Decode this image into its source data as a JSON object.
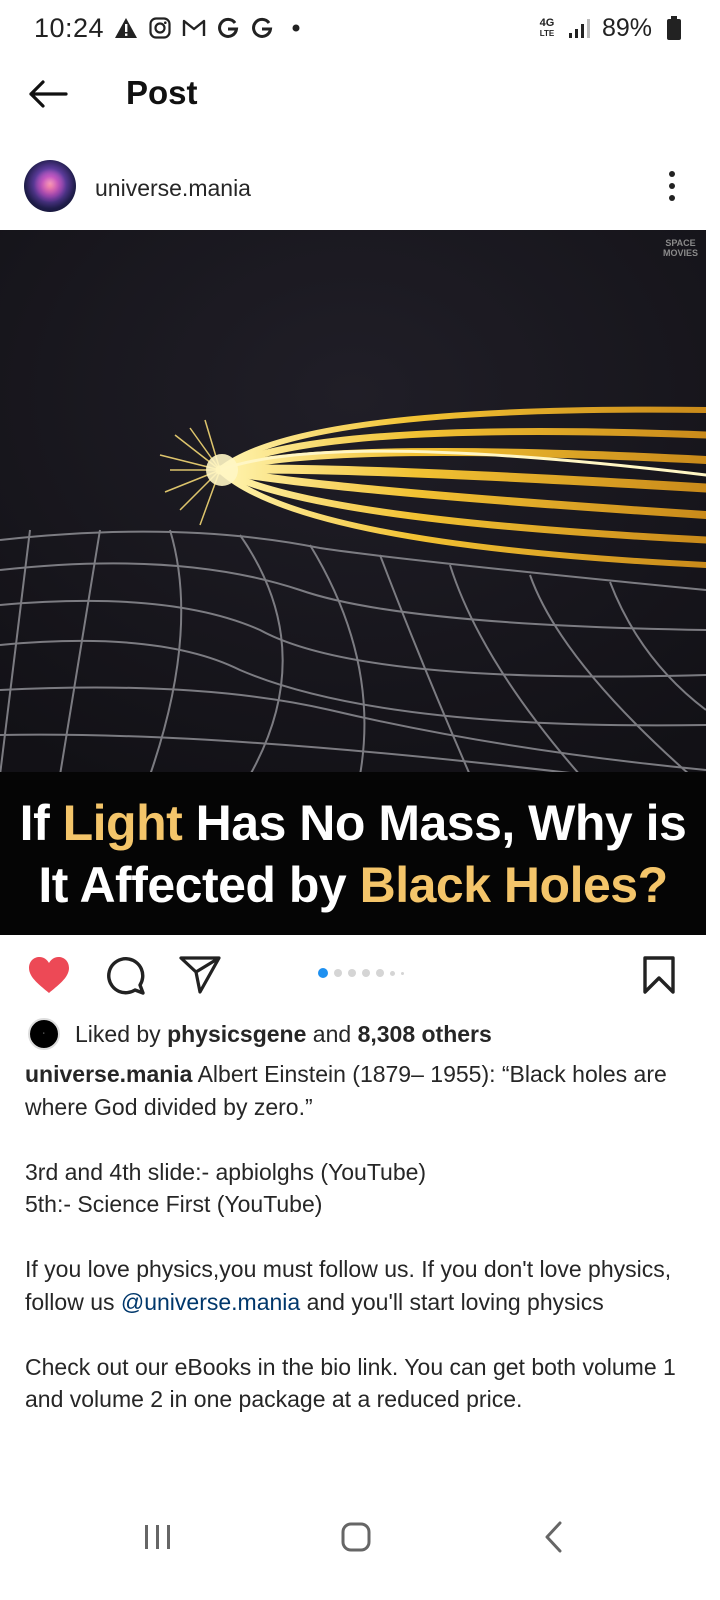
{
  "status_bar": {
    "time": "10:24",
    "notification_icons": [
      "warning-icon",
      "instagram-icon",
      "gmail-icon",
      "google-icon",
      "google-icon",
      "dot-icon"
    ],
    "network_label_top": "4G",
    "network_label_bottom": "LTE",
    "battery": "89%"
  },
  "header": {
    "title": "Post"
  },
  "post": {
    "username": "universe.mania",
    "media": {
      "watermark_line1": "SPACE",
      "watermark_line2": "MOVIES",
      "headline_line1_a": "If ",
      "headline_line1_highlight": "Light",
      "headline_line1_b": " Has No Mass, Why is",
      "headline_line2_a": "It Affected by ",
      "headline_line2_highlight": "Black Holes?",
      "highlight_color": "#f4c56a"
    },
    "carousel": {
      "active_index": 0,
      "count": 7
    },
    "likes": {
      "prefix": "Liked by ",
      "liker": "physicsgene",
      "middle": " and ",
      "others": "8,308 others"
    },
    "caption": {
      "username": "universe.mania",
      "text1": " Albert Einstein (1879– 1955): “Black holes are where God divided by zero.”",
      "credit1": "3rd and 4th slide:- apbiolghs (YouTube)",
      "credit2": "5th:- Science First (YouTube)",
      "follow_a": "If you love physics,you must follow us. If you don't love physics, follow us ",
      "mention": "@universe.mania",
      "follow_b": " and you'll start loving physics",
      "ebooks": "Check out our eBooks in the bio link. You can get both volume 1 and volume 2 in one package at a reduced price."
    }
  },
  "colors": {
    "like_red": "#ed4956",
    "link_blue": "#00376b",
    "dot_active": "#1e90f0"
  }
}
